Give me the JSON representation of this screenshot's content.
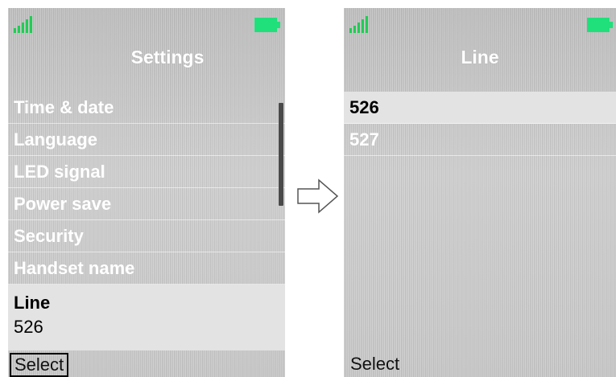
{
  "left_screen": {
    "title": "Settings",
    "items": [
      "Time & date",
      "Language",
      "LED signal",
      "Power save",
      "Security",
      "Handset name"
    ],
    "selected_item": {
      "label": "Line",
      "value": "526"
    },
    "softkey": "Select",
    "scrollbar_visible": true
  },
  "right_screen": {
    "title": "Line",
    "items": [
      "526",
      "527"
    ],
    "selected_index": 0,
    "softkey": "Select"
  },
  "icons": {
    "signal": "signal-strength-icon",
    "battery": "battery-icon",
    "transition_arrow": "arrow-right-icon"
  },
  "colors": {
    "status_green": "#22cc55",
    "highlight": "#e3e3e3",
    "menu_text": "#ffffff"
  }
}
